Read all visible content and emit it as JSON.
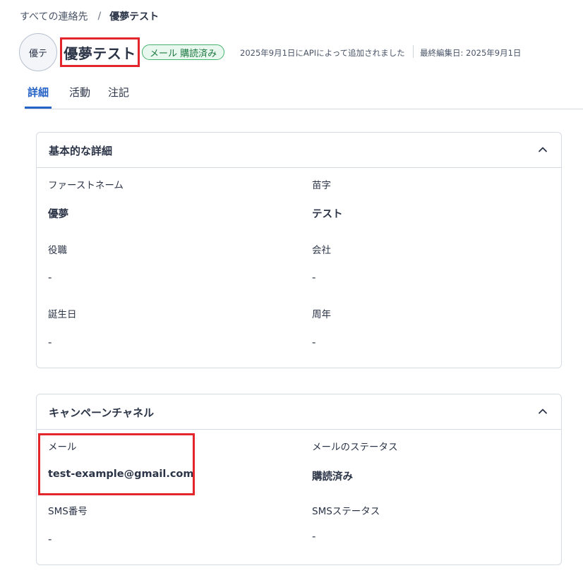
{
  "breadcrumb": {
    "parent": "すべての連絡先",
    "separator": "/",
    "current": "優夢テスト"
  },
  "contact": {
    "avatar_initials": "優テ",
    "name": "優夢テスト",
    "badge": "メール 購読済み",
    "added": "2025年9月1日にAPIによって追加されました",
    "last_edited": "最終編集日: 2025年9月1日"
  },
  "tabs": [
    {
      "label": "詳細",
      "active": true
    },
    {
      "label": "活動",
      "active": false
    },
    {
      "label": "注記",
      "active": false
    }
  ],
  "basic": {
    "title": "基本的な詳細",
    "first_name_label": "ファーストネーム",
    "first_name_value": "優夢",
    "last_name_label": "苗字",
    "last_name_value": "テスト",
    "job_title_label": "役職",
    "job_title_value": "-",
    "company_label": "会社",
    "company_value": "-",
    "birthday_label": "誕生日",
    "birthday_value": "-",
    "anniversary_label": "周年",
    "anniversary_value": "-"
  },
  "campaign": {
    "title": "キャンペーンチャネル",
    "email_label": "メール",
    "email_value": "test-example@gmail.com",
    "email_status_label": "メールのステータス",
    "email_status_value": "購読済み",
    "sms_number_label": "SMS番号",
    "sms_number_value": "-",
    "sms_status_label": "SMSステータス",
    "sms_status_value": "-"
  },
  "colors": {
    "accent": "#2563c6",
    "highlight": "#e3262c",
    "badge_green": "#44b36c"
  },
  "icons": {
    "collapse": "chevron-up-icon"
  }
}
